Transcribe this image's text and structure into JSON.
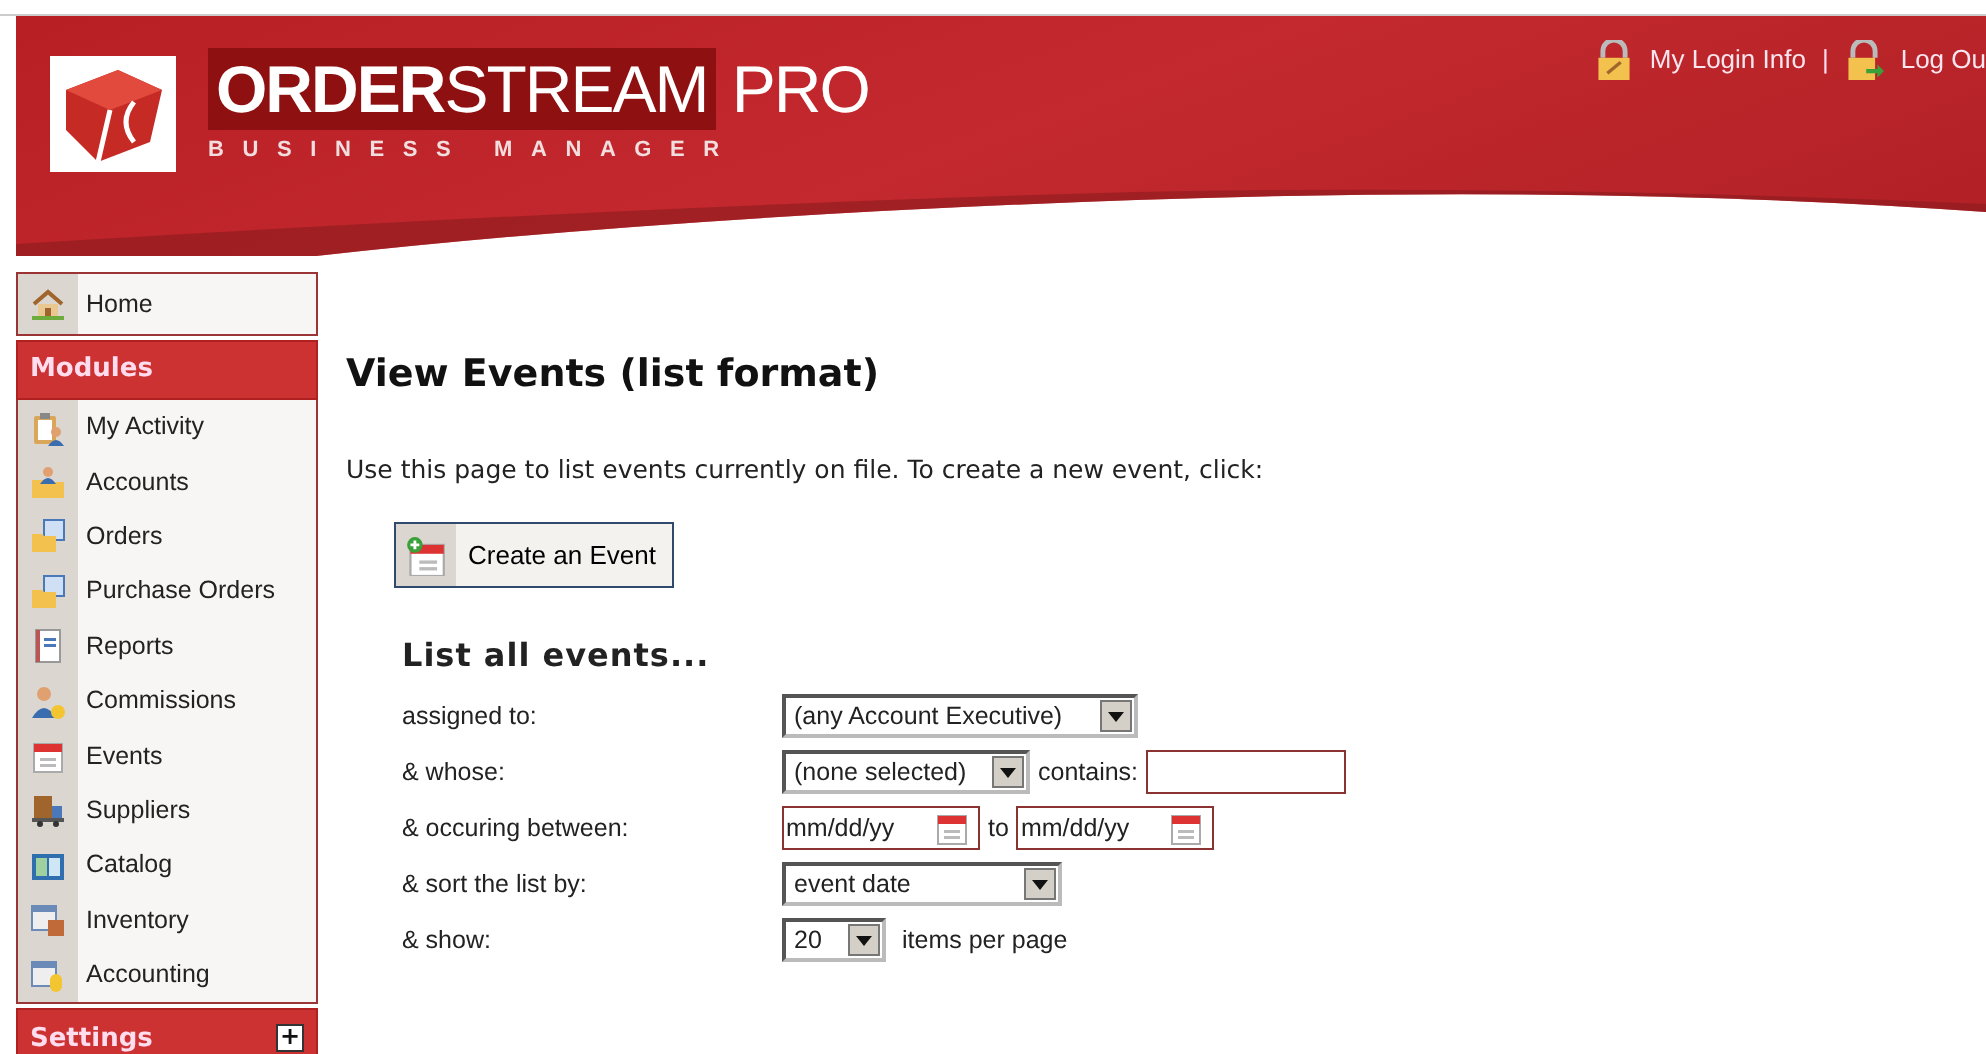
{
  "header": {
    "brand": "**ORDER**STREAM",
    "suffix": "PRO",
    "tagline": "BUSINESS MANAGER",
    "links": [
      {
        "label": "My Login Info"
      },
      {
        "label": "Log Ou"
      }
    ],
    "separator": "|"
  },
  "sidebar": {
    "home": {
      "label": "Home"
    },
    "sections": [
      {
        "title": "Modules",
        "expanded": true,
        "items": [
          {
            "label": "My Activity"
          },
          {
            "label": "Accounts"
          },
          {
            "label": "Orders"
          },
          {
            "label": "Purchase Orders"
          },
          {
            "label": "Reports"
          },
          {
            "label": "Commissions"
          },
          {
            "label": "Events"
          },
          {
            "label": "Suppliers"
          },
          {
            "label": "Catalog"
          },
          {
            "label": "Inventory"
          },
          {
            "label": "Accounting"
          }
        ]
      },
      {
        "title": "Settings",
        "expanded": false,
        "toggle": "+"
      }
    ]
  },
  "main": {
    "title": "View Events (list format)",
    "intro": "Use this page to list events currently on file. To create a new event, click:",
    "create_button": "Create an Event",
    "form": {
      "heading": "List all events...",
      "rows": [
        {
          "kind": "select",
          "label": "assigned to:",
          "value": "(any Account Executive)"
        },
        {
          "kind": "select-text",
          "label": "& whose:",
          "value": "(none selected)",
          "between": "contains:"
        },
        {
          "kind": "dates",
          "label": "& occuring between:",
          "placeholder": "mm/dd/yy",
          "between": "to",
          "placeholder2": "mm/dd/yy"
        },
        {
          "kind": "select-mid",
          "label": "& sort the list by:",
          "value": "event date"
        },
        {
          "kind": "select-after",
          "label": "& show:",
          "value": "20",
          "after": "items per page"
        }
      ]
    }
  }
}
